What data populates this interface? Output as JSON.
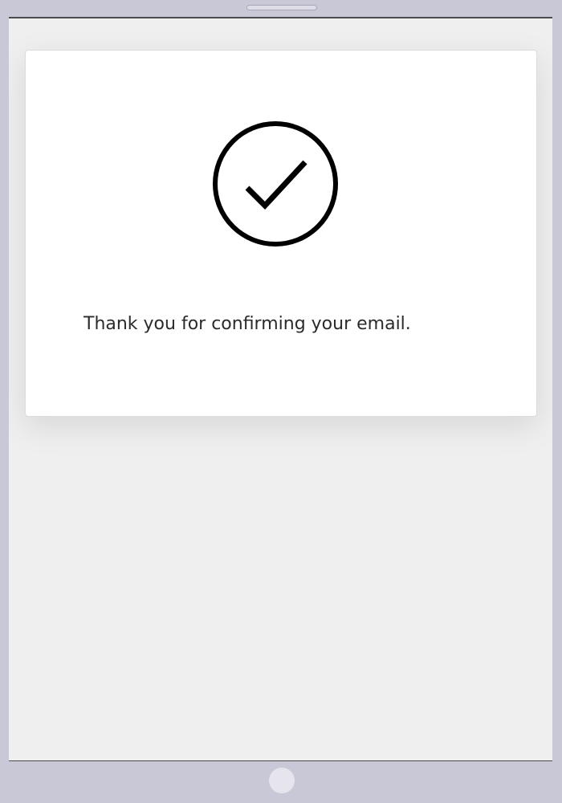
{
  "device": {
    "frame_color": "#c9c8d6",
    "screen_background": "#efefef"
  },
  "confirmation": {
    "icon": "check-circle-icon",
    "message": "Thank you for confirming your email."
  }
}
